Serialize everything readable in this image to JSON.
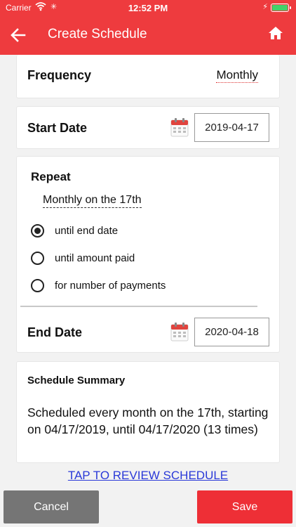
{
  "status_bar": {
    "carrier": "Carrier",
    "time": "12:52 PM",
    "battery_level": 1.0
  },
  "header": {
    "title": "Create Schedule",
    "back_icon": "arrow-left-icon",
    "home_icon": "home-icon",
    "background": "#ee3b3e"
  },
  "frequency": {
    "label": "Frequency",
    "value": "Monthly"
  },
  "start_date": {
    "label": "Start Date",
    "value": "2019-04-17",
    "icon": "calendar-icon"
  },
  "repeat": {
    "label": "Repeat",
    "value": "Monthly on the 17th",
    "options": [
      {
        "label": "until end date",
        "selected": true
      },
      {
        "label": "until amount paid",
        "selected": false
      },
      {
        "label": "for number of payments",
        "selected": false
      }
    ]
  },
  "end_date": {
    "label": "End Date",
    "value": "2020-04-18",
    "icon": "calendar-icon"
  },
  "summary": {
    "title": "Schedule Summary",
    "text": "Scheduled every month on the 17th, starting on 04/17/2019, until 04/17/2020 (13 times)"
  },
  "review_link": "TAP TO REVIEW SCHEDULE",
  "actions": {
    "cancel": "Cancel",
    "save": "Save",
    "cancel_color": "#757575",
    "save_color": "#ee2f36"
  }
}
